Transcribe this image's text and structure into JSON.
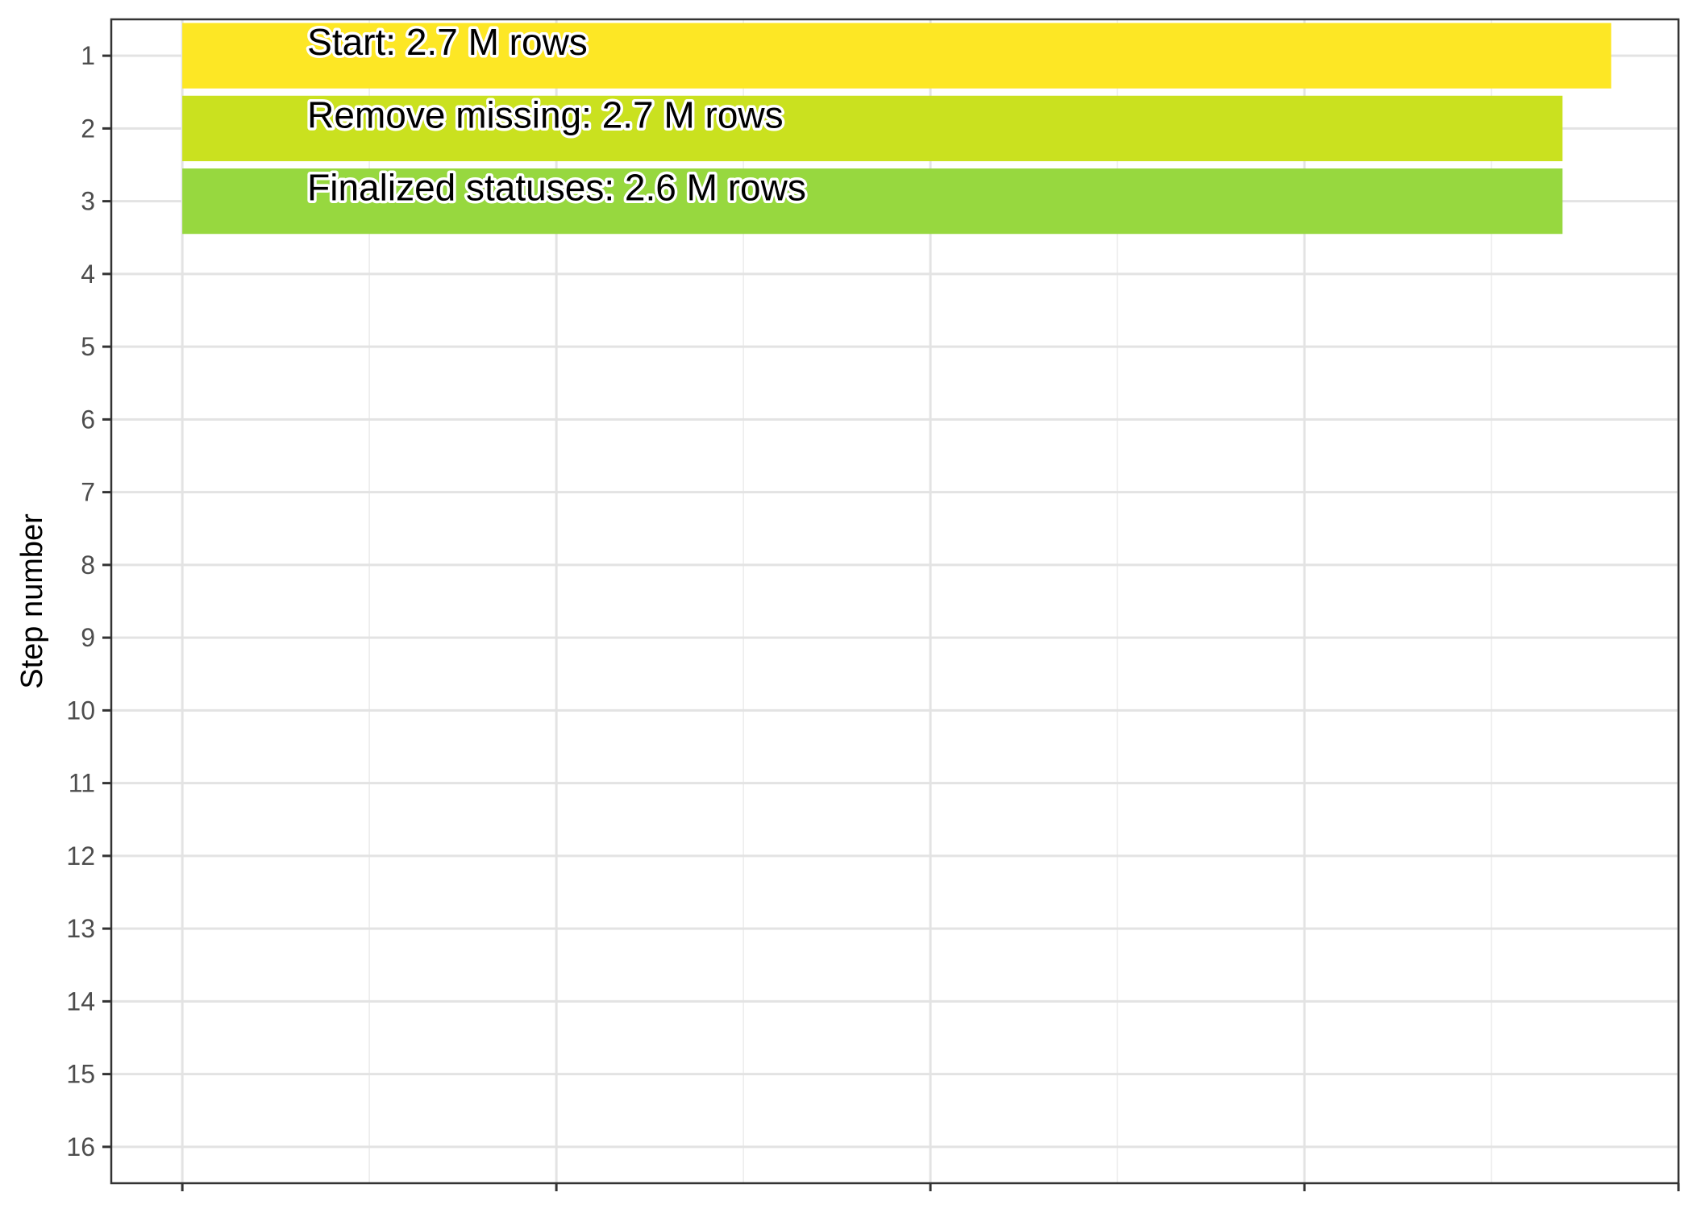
{
  "chart_data": {
    "type": "bar",
    "orientation": "horizontal",
    "ylabel": "Step number",
    "xlabel": "",
    "y_ticks": [
      "1",
      "2",
      "3",
      "4",
      "5",
      "6",
      "7",
      "8",
      "9",
      "10",
      "11",
      "12",
      "13",
      "14",
      "15",
      "16"
    ],
    "ylim": [
      0.5,
      16.5
    ],
    "xlim": [
      -0.19,
      4.0
    ],
    "x_ticks": [
      0,
      1,
      2,
      3,
      4
    ],
    "grid": true,
    "bars": [
      {
        "step": 1,
        "value": 3.82,
        "label": "Start:  2.7 M rows",
        "color": "#fde725"
      },
      {
        "step": 2,
        "value": 3.69,
        "label": "Remove missing:  2.7 M rows",
        "color": "#cae11f"
      },
      {
        "step": 3,
        "value": 3.69,
        "label": "Finalized statuses:  2.6 M rows",
        "color": "#97d83f"
      }
    ]
  }
}
